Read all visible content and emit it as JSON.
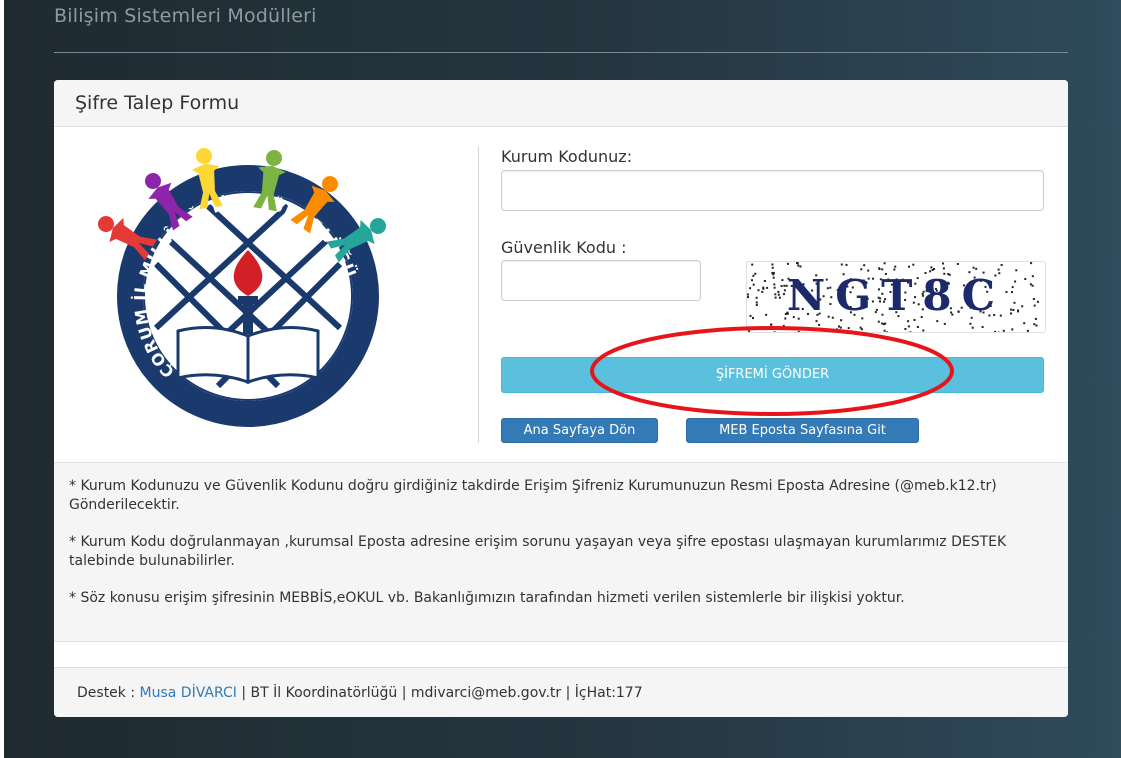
{
  "header": {
    "title": "Bilişim Sistemleri Modülleri"
  },
  "panel": {
    "title": "Şifre Talep Formu"
  },
  "logo": {
    "top_text": "MİLLÎ EĞİTİM MÜDÜRLÜĞÜ",
    "left_text": "ÇORUM İL",
    "person_colors": [
      "#e53935",
      "#8e24aa",
      "#fdd835",
      "#7cb342",
      "#fb8c00",
      "#26a69a"
    ]
  },
  "form": {
    "kurum_label": "Kurum Kodunuz:",
    "kurum_value": "",
    "guvenlik_label": "Güvenlik Kodu :",
    "guvenlik_value": "",
    "captcha_text": "NGT8C",
    "submit_label": "ŞİFREMİ GÖNDER",
    "home_label": "Ana Sayfaya Dön",
    "mail_label": "MEB Eposta Sayfasına Git"
  },
  "notes": [
    "* Kurum Kodunuzu ve Güvenlik Kodunu doğru girdiğiniz takdirde Erişim Şifreniz Kurumunuzun Resmi Eposta Adresine (@meb.k12.tr) Gönderilecektir.",
    "* Kurum Kodu doğrulanmayan ,kurumsal Eposta adresine erişim sorunu yaşayan veya şifre epostası ulaşmayan kurumlarımız DESTEK talebinde bulunabilirler.",
    "* Söz konusu erişim şifresinin MEBBİS,eOKUL vb. Bakanlığımızın tarafından hizmeti verilen sistemlerle bir ilişkisi yoktur."
  ],
  "footer": {
    "prefix": "Destek : ",
    "contact_name": "Musa DİVARCI",
    "suffix": " | BT İl Koordinatörlüğü | mdivarci@meb.gov.tr | İçHat:177"
  },
  "colors": {
    "info_button": "#5bc0de",
    "primary_button": "#337ab7",
    "annotation": "#e8141b",
    "logo_navy": "#1a3a6e",
    "logo_red": "#d32027"
  }
}
